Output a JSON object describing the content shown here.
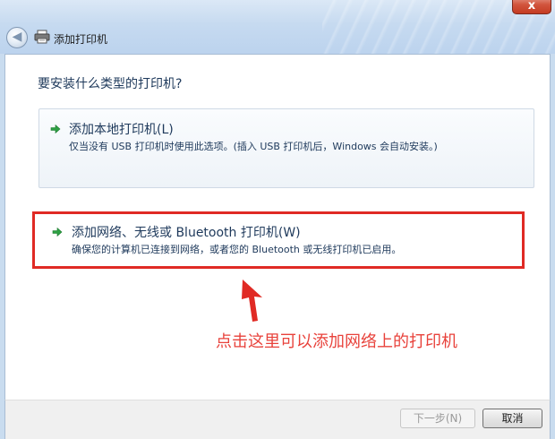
{
  "window": {
    "title": "添加打印机",
    "close_label": "x"
  },
  "content": {
    "question": "要安装什么类型的打印机?",
    "options": [
      {
        "title": "添加本地打印机(L)",
        "description": "仅当没有 USB 打印机时使用此选项。(插入 USB 打印机后，Windows 会自动安装。)"
      },
      {
        "title": "添加网络、无线或 Bluetooth 打印机(W)",
        "description": "确保您的计算机已连接到网络，或者您的 Bluetooth 或无线打印机已启用。"
      }
    ]
  },
  "annotation": {
    "text": "点击这里可以添加网络上的打印机",
    "color": "#e02a24"
  },
  "footer": {
    "next_label": "下一步(N)",
    "cancel_label": "取消"
  },
  "colors": {
    "arrow_green": "#2ea043",
    "text_blue": "#1e395b"
  }
}
